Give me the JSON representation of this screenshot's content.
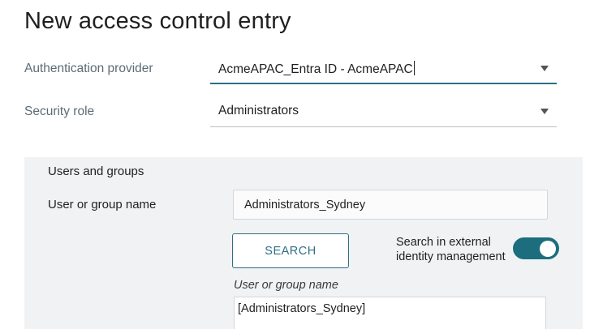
{
  "page": {
    "title": "New access control entry"
  },
  "form": {
    "auth_provider": {
      "label": "Authentication provider",
      "value": "AcmeAPAC_Entra ID - AcmeAPAC"
    },
    "security_role": {
      "label": "Security role",
      "value": "Administrators"
    }
  },
  "users_groups": {
    "section_title": "Users and groups",
    "name_label": "User or group name",
    "name_value": "Administrators_Sydney",
    "search_button": "SEARCH",
    "external_search_label": "Search in external identity management",
    "external_search_enabled": true,
    "results_label": "User or group name",
    "results": [
      "[Administrators_Sydney]"
    ]
  },
  "colors": {
    "accent": "#2d6e86",
    "toggle_on": "#1c6e7f",
    "panel_bg": "#f1f2f3"
  }
}
